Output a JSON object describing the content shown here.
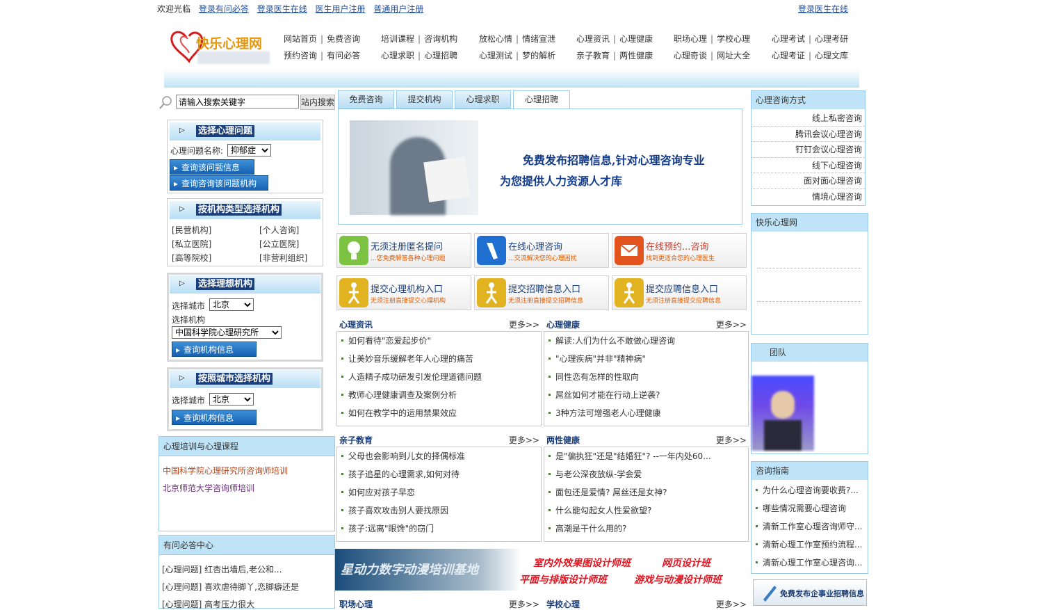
{
  "topbar": {
    "welcome": "欢迎光临",
    "links": [
      "登录有问必答",
      "登录医生在线",
      "医生用户注册",
      "普通用户注册"
    ],
    "right_link": "登录医生在线"
  },
  "logo": {
    "text": "快乐心理网"
  },
  "nav": [
    [
      "网站首页",
      "免费咨询",
      "预约咨询",
      "有问必答"
    ],
    [
      "培训课程",
      "咨询机构",
      "心理求职",
      "心理招聘"
    ],
    [
      "放松心情",
      "情绪宣泄",
      "心理测试",
      "梦的解析"
    ],
    [
      "心理资讯",
      "心理健康",
      "亲子教育",
      "两性健康"
    ],
    [
      "职场心理",
      "学校心理",
      "心理奇谈",
      "网址大全"
    ],
    [
      "心理考试",
      "心理考研",
      "心理考证",
      "心理文库"
    ]
  ],
  "search": {
    "placeholder": "请输入搜索关键字",
    "button": "站内搜索"
  },
  "left": {
    "problem": {
      "title": "选择心理问题",
      "label": "心理问题名称:",
      "selected": "抑郁症",
      "btn1": "查询该问题信息",
      "btn2": "查询咨询该问题机构"
    },
    "orgtype": {
      "title": "按机构类型选择机构",
      "items": [
        "[民营机构]",
        "[个人咨询]",
        "[私立医院]",
        "[公立医院]",
        "[高等院校]",
        "[非营利组织]"
      ]
    },
    "ideal": {
      "title": "选择理想机构",
      "city_label": "选择城市",
      "city": "北京",
      "org_label": "选择机构",
      "org": "中国科学院心理研究所",
      "btn": "查询机构信息"
    },
    "bycity": {
      "title": "按照城市选择机构",
      "city_label": "选择城市",
      "city": "北京",
      "btn": "查询机构信息"
    },
    "training": {
      "title": "心理培训与心理课程",
      "items": [
        "中国科学院心理研究所咨询师培训",
        "北京师范大学咨询师培训"
      ]
    },
    "qa": {
      "title": "有问必答中心",
      "items": [
        "[心理问题] 红杏出墙后,老公和...",
        "[心理问题] 喜欢虐待脚丫,恋脚癖还是",
        "[心理问题] 高考压力很大"
      ]
    }
  },
  "tabs": [
    "免费咨询",
    "提交机构",
    "心理求职",
    "心理招聘"
  ],
  "banner": {
    "line1": "免费发布招聘信息,针对心理咨询专业",
    "line2": "为您提供人力资源人才库"
  },
  "features": [
    {
      "t1": "无须注册匿名提问",
      "t2": "...您免费解答各种心理问题",
      "color": "#7cc243"
    },
    {
      "t1": "在线心理咨询",
      "t2": "...交流解决您的心理困扰",
      "color": "#1f6fd1"
    },
    {
      "t1": "在线预约...咨询",
      "t2": "找到更适合您的心理医生",
      "color": "#e2531d"
    },
    {
      "t1": "提交心理机构入口",
      "t2": "无须注册直接提交心理机构",
      "color": "#e2b321"
    },
    {
      "t1": "提交招聘信息入口",
      "t2": "无须注册直接提交招聘信息",
      "color": "#e2b321"
    },
    {
      "t1": "提交应聘信息入口",
      "t2": "无须注册直接提交应聘信息",
      "color": "#e2b321"
    }
  ],
  "sections": {
    "zixun": {
      "title": "心理资讯",
      "more": "更多>>",
      "items": [
        "如何看待\"恋爱起步价\"",
        "让美妙音乐缓解老年人心理的痛苦",
        "人造精子成功研发引发伦理道德问题",
        "教师心理健康调查及案例分析",
        "如何在教学中的运用禁果效应"
      ]
    },
    "jiankang": {
      "title": "心理健康",
      "more": "更多>>",
      "items": [
        "解读:人们为什么不敢做心理咨询",
        "\"心理疾病\"并非\"精神病\"",
        "同性恋有怎样的性取向",
        "屌丝如何才能在行动上逆袭?",
        "3种方法可增强老人心理健康"
      ]
    },
    "qinzi": {
      "title": "亲子教育",
      "more": "更多>>",
      "items": [
        "父母也会影响到儿女的择偶标准",
        "孩子追星的心理需求,如何对待",
        "如何应对孩子早恋",
        "孩子喜欢攻击别人要找原因",
        "孩子:远离\"眼馋\"的窃门"
      ]
    },
    "liangxing": {
      "title": "两性健康",
      "more": "更多>>",
      "items": [
        "是\"偏执狂\"还是\"结婚狂\"? --一年内处60...",
        "与老公深夜放纵-学会爱",
        "面包还是爱情? 屌丝还是女神?",
        "什么能勾起女人性爱欲望?",
        "高潮是干什么用的?"
      ]
    },
    "zhichang": {
      "title": "职场心理",
      "more": "更多>>"
    },
    "xuexiao": {
      "title": "学校心理",
      "more": "更多>>"
    }
  },
  "ad": {
    "left": "星动力数字动漫培训基地",
    "r1": "室内外效果图设计师班",
    "r2": "网页设计班",
    "r3": "平面与排版设计师班",
    "r4": "游戏与动漫设计师班"
  },
  "right": {
    "ways": {
      "title": "心理咨询方式",
      "items": [
        "线上私密咨询",
        "腾讯会议心理咨询",
        "钉钉会议心理咨询",
        "线下心理咨询",
        "面对面心理咨询",
        "情境心理咨询"
      ]
    },
    "happy": {
      "title": "快乐心理网"
    },
    "team": {
      "title": "团队"
    },
    "guide": {
      "title": "咨询指南",
      "items": [
        "为什么心理咨询要收费?...",
        "哪些情况需要心理咨询",
        "清新工作室心理咨询师守...",
        "清新心理工作室预约流程...",
        "清新心理工作室心理咨询..."
      ]
    },
    "banner": "免费发布企事业招聘信息"
  }
}
